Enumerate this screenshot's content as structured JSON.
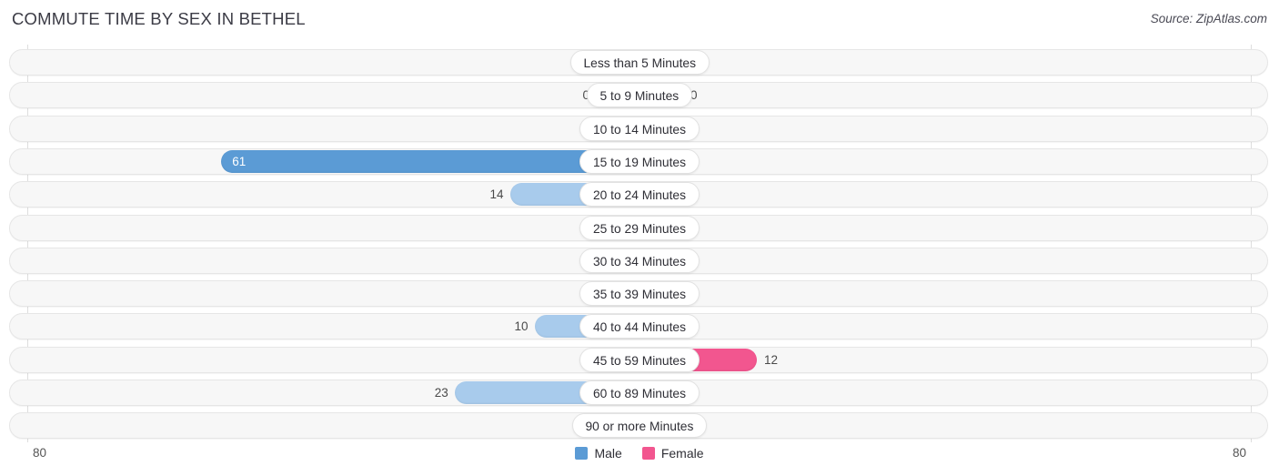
{
  "header": {
    "title": "COMMUTE TIME BY SEX IN BETHEL",
    "source": "Source: ZipAtlas.com"
  },
  "legend": {
    "male": {
      "label": "Male",
      "color": "#5b9bd5"
    },
    "female": {
      "label": "Female",
      "color": "#f2568f"
    }
  },
  "axis": {
    "left_label": "80",
    "right_label": "80",
    "max": 80
  },
  "colors": {
    "male_light": "#a8cbec",
    "male_strong": "#5b9bd5",
    "female_light": "#f9a8c5",
    "female_strong": "#f2568f",
    "track": "#f7f7f7",
    "gridline": "#dedede"
  },
  "chart_data": {
    "type": "bar",
    "title": "COMMUTE TIME BY SEX IN BETHEL",
    "subtitle": "Source: ZipAtlas.com",
    "orientation": "horizontal-diverging",
    "xlabel": "",
    "ylabel": "",
    "xlim": [
      80,
      80
    ],
    "grid": true,
    "legend_position": "bottom-center",
    "categories": [
      "Less than 5 Minutes",
      "5 to 9 Minutes",
      "10 to 14 Minutes",
      "15 to 19 Minutes",
      "20 to 24 Minutes",
      "25 to 29 Minutes",
      "30 to 34 Minutes",
      "35 to 39 Minutes",
      "40 to 44 Minutes",
      "45 to 59 Minutes",
      "60 to 89 Minutes",
      "90 or more Minutes"
    ],
    "series": [
      {
        "name": "Male",
        "color": "#5b9bd5",
        "values": [
          0,
          0,
          0,
          61,
          14,
          0,
          0,
          0,
          10,
          0,
          23,
          0
        ]
      },
      {
        "name": "Female",
        "color": "#f2568f",
        "values": [
          0,
          0,
          0,
          0,
          0,
          0,
          0,
          0,
          0,
          12,
          0,
          0
        ]
      }
    ]
  },
  "rows": [
    {
      "label": "Less than 5 Minutes",
      "male": "0",
      "female": "0"
    },
    {
      "label": "5 to 9 Minutes",
      "male": "0",
      "female": "0"
    },
    {
      "label": "10 to 14 Minutes",
      "male": "0",
      "female": "0"
    },
    {
      "label": "15 to 19 Minutes",
      "male": "61",
      "female": "0"
    },
    {
      "label": "20 to 24 Minutes",
      "male": "14",
      "female": "0"
    },
    {
      "label": "25 to 29 Minutes",
      "male": "0",
      "female": "0"
    },
    {
      "label": "30 to 34 Minutes",
      "male": "0",
      "female": "0"
    },
    {
      "label": "35 to 39 Minutes",
      "male": "0",
      "female": "0"
    },
    {
      "label": "40 to 44 Minutes",
      "male": "10",
      "female": "0"
    },
    {
      "label": "45 to 59 Minutes",
      "male": "0",
      "female": "12"
    },
    {
      "label": "60 to 89 Minutes",
      "male": "23",
      "female": "0"
    },
    {
      "label": "90 or more Minutes",
      "male": "0",
      "female": "0"
    }
  ]
}
